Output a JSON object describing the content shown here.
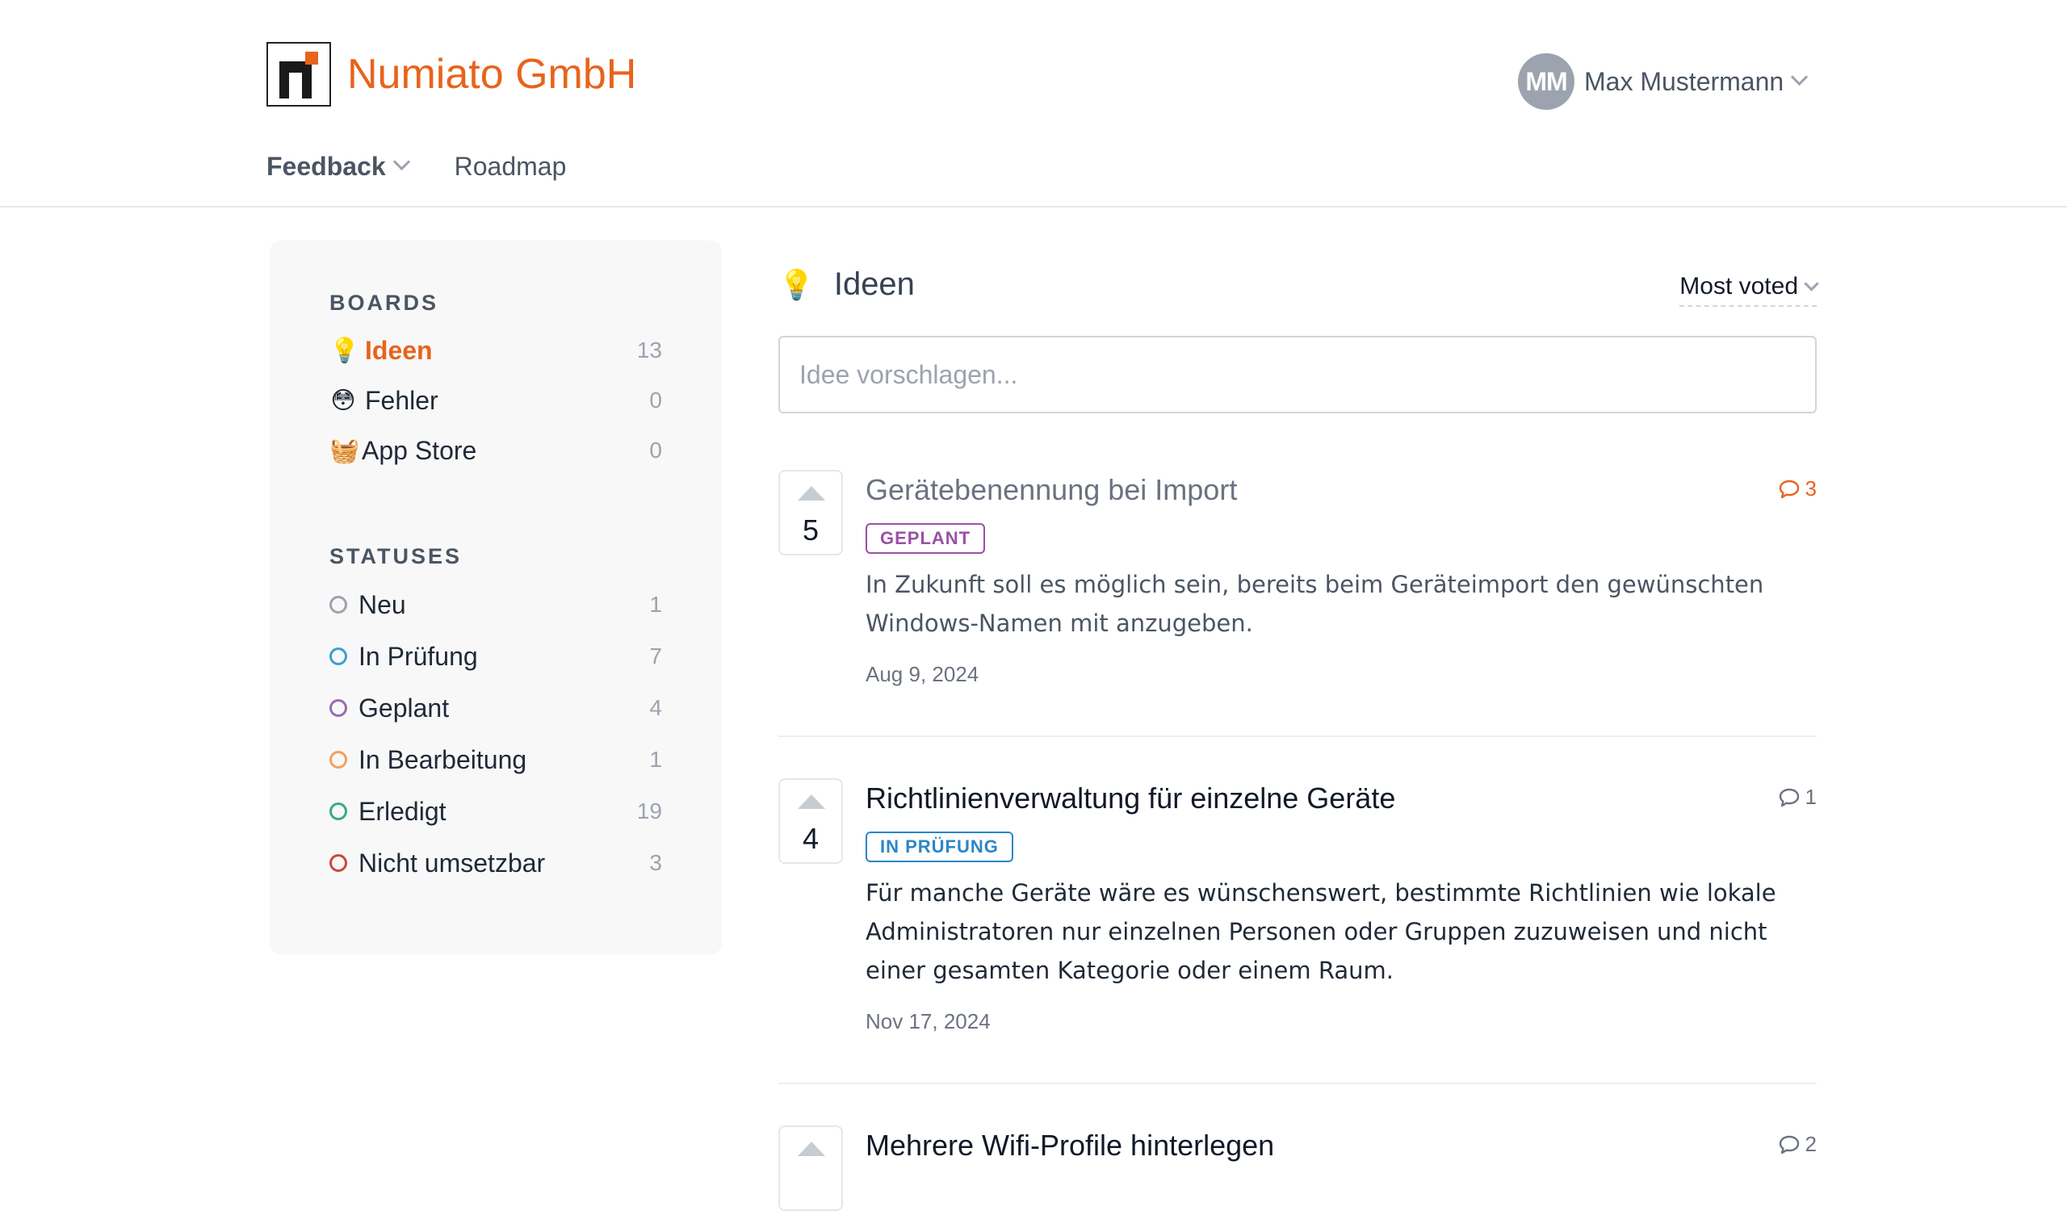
{
  "brand": {
    "name": "Numiato GmbH"
  },
  "user": {
    "initials": "MM",
    "name": "Max Mustermann"
  },
  "nav": {
    "feedback": "Feedback",
    "roadmap": "Roadmap"
  },
  "sidebar": {
    "boards_title": "BOARDS",
    "boards": [
      {
        "emoji": "💡",
        "label": "Ideen",
        "count": "13"
      },
      {
        "emoji": "😳",
        "label": "Fehler",
        "count": "0"
      },
      {
        "emoji": "🧺",
        "label": "App Store",
        "count": "0"
      }
    ],
    "statuses_title": "STATUSES",
    "statuses": [
      {
        "label": "Neu",
        "count": "1",
        "color": "#9ca3af"
      },
      {
        "label": "In Prüfung",
        "count": "7",
        "color": "#3b9fd6"
      },
      {
        "label": "Geplant",
        "count": "4",
        "color": "#9b6ab8"
      },
      {
        "label": "In Bearbeitung",
        "count": "1",
        "color": "#f2a15a"
      },
      {
        "label": "Erledigt",
        "count": "19",
        "color": "#3aa88a"
      },
      {
        "label": "Nicht umsetzbar",
        "count": "3",
        "color": "#c9493a"
      }
    ]
  },
  "main": {
    "board_emoji": "💡",
    "board_title": "Ideen",
    "sort_label": "Most voted",
    "suggest_placeholder": "Idee vorschlagen...",
    "posts": [
      {
        "votes": "5",
        "title": "Gerätebenennung bei Import",
        "status": "GEPLANT",
        "status_color": "#9b4fa6",
        "comments": "3",
        "description": "In Zukunft soll es möglich sein, bereits beim Geräteimport den gewünschten Windows-Namen mit anzugeben.",
        "date": "Aug 9, 2024"
      },
      {
        "votes": "4",
        "title": "Richtlinienverwaltung für einzelne Geräte",
        "status": "IN PRÜFUNG",
        "status_color": "#2a86c8",
        "comments": "1",
        "description": "Für manche Geräte wäre es wünschenswert, bestimmte Richtlinien wie lokale Administratoren nur einzelnen Personen oder Gruppen zuzuweisen und nicht einer gesamten Kategorie oder einem Raum.",
        "date": "Nov 17, 2024"
      },
      {
        "votes": "",
        "title": "Mehrere Wifi-Profile hinterlegen",
        "comments": "2"
      }
    ]
  }
}
